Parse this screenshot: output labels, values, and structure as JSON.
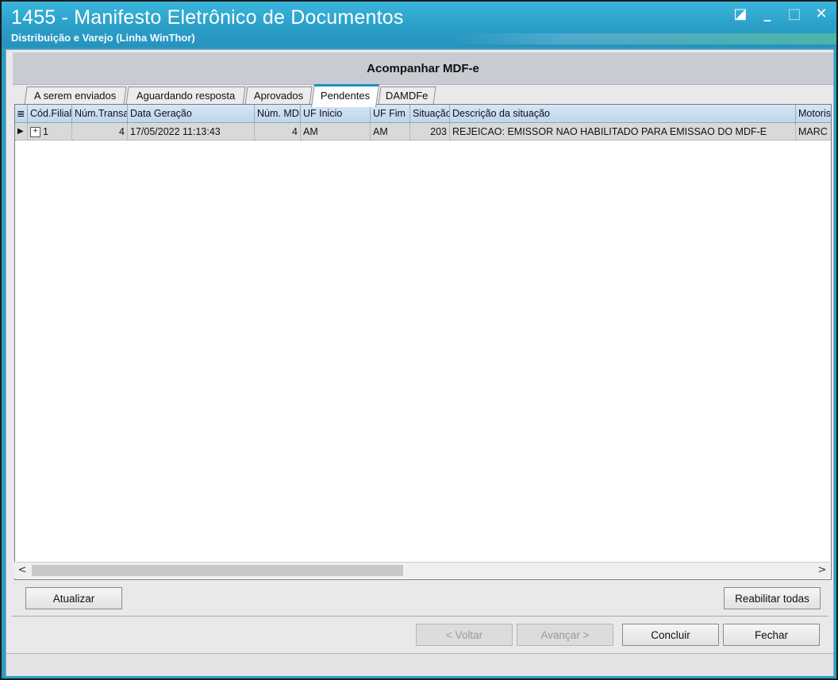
{
  "window": {
    "title": "1455 - Manifesto Eletrônico de Documentos",
    "subtitle": "Distribuição e Varejo (Linha WinThor)",
    "controls": {
      "restore": "◪",
      "minimize": "_",
      "maximize": "□",
      "close": "✕"
    }
  },
  "header": {
    "title": "Acompanhar MDF-e"
  },
  "tabs": [
    {
      "label": "A serem enviados",
      "active": false
    },
    {
      "label": "Aguardando resposta",
      "active": false
    },
    {
      "label": "Aprovados",
      "active": false
    },
    {
      "label": "Pendentes",
      "active": true
    },
    {
      "label": "DAMDFe",
      "active": false
    }
  ],
  "grid": {
    "columns": [
      "Cód.Filial",
      "Núm.Transação",
      "Data Geração",
      "Núm. MDF-e",
      "UF Inicio",
      "UF Fim",
      "Situação",
      "Descrição da situação",
      "Motorista"
    ],
    "rows": [
      {
        "expand": "+",
        "cod_filial": "1",
        "num_trans": "4",
        "data_geracao": "17/05/2022 11:13:43",
        "num_mdfe": "4",
        "uf_inicio": "AM",
        "uf_fim": "AM",
        "situacao": "203",
        "descricao": "REJEICAO: EMISSOR NAO HABILITADO PARA EMISSAO DO MDF-E",
        "motorista": "MARC"
      }
    ],
    "row_indicator": "▶",
    "column_chooser_icon": "≣"
  },
  "scroll": {
    "left": "<",
    "right": ">"
  },
  "buttons": {
    "atualizar": "Atualizar",
    "reabilitar": "Reabilitar todas",
    "voltar": "< Voltar",
    "avancar": "Avançar >",
    "concluir": "Concluir",
    "fechar": "Fechar"
  },
  "colors": {
    "titlebar": "#2a9fc4",
    "active_tab_border": "#1f8fc0",
    "selected_row": "#d9d9d9"
  }
}
